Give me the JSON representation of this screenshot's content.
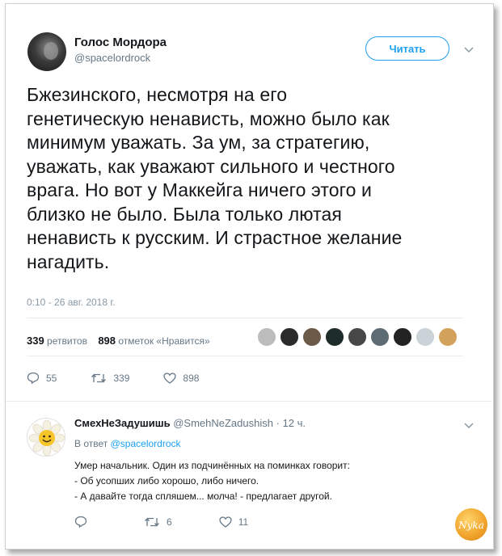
{
  "tweet": {
    "author_name": "Голос Мордора",
    "author_handle": "@spacelordrock",
    "follow_label": "Читать",
    "text_lines": [
      "Бжезинского, несмотря на его",
      "генетическую ненависть, можно было как",
      "минимум уважать. За ум, за стратегию,",
      "уважать, как уважают сильного и честного",
      "врага. Но вот у Маккейга ничего этого и",
      "близко не было. Была только лютая",
      "ненависть к русским. И страстное желание",
      "нагадить."
    ],
    "timestamp": "0:10 - 26 авг. 2018 г.",
    "retweets_count": "339",
    "retweets_label": "ретвитов",
    "likes_count": "898",
    "likes_label": "отметок «Нравится»",
    "actions": {
      "replies": "55",
      "retweets": "339",
      "likes": "898"
    }
  },
  "reply": {
    "name": "СмехНеЗадушишь",
    "handle": "@SmehNeZadushish",
    "time": "· 12 ч.",
    "reply_to_prefix": "В ответ",
    "reply_to_handle": "@spacelordrock",
    "lines": [
      "Умер начальник. Один из подчинённых на поминках говорит:",
      "- Об усопших либо хорошо, либо ничего.",
      "- А давайте тогда спляшем... молча! - предлагает другой."
    ],
    "actions": {
      "retweets": "6",
      "likes": "11"
    }
  },
  "watermark_text": "Nyka",
  "icons": [
    "chevron-down-icon",
    "reply-icon",
    "retweet-icon",
    "heart-icon"
  ],
  "colors": {
    "accent": "#1da1f2",
    "muted": "#657786",
    "text": "#14171a"
  }
}
